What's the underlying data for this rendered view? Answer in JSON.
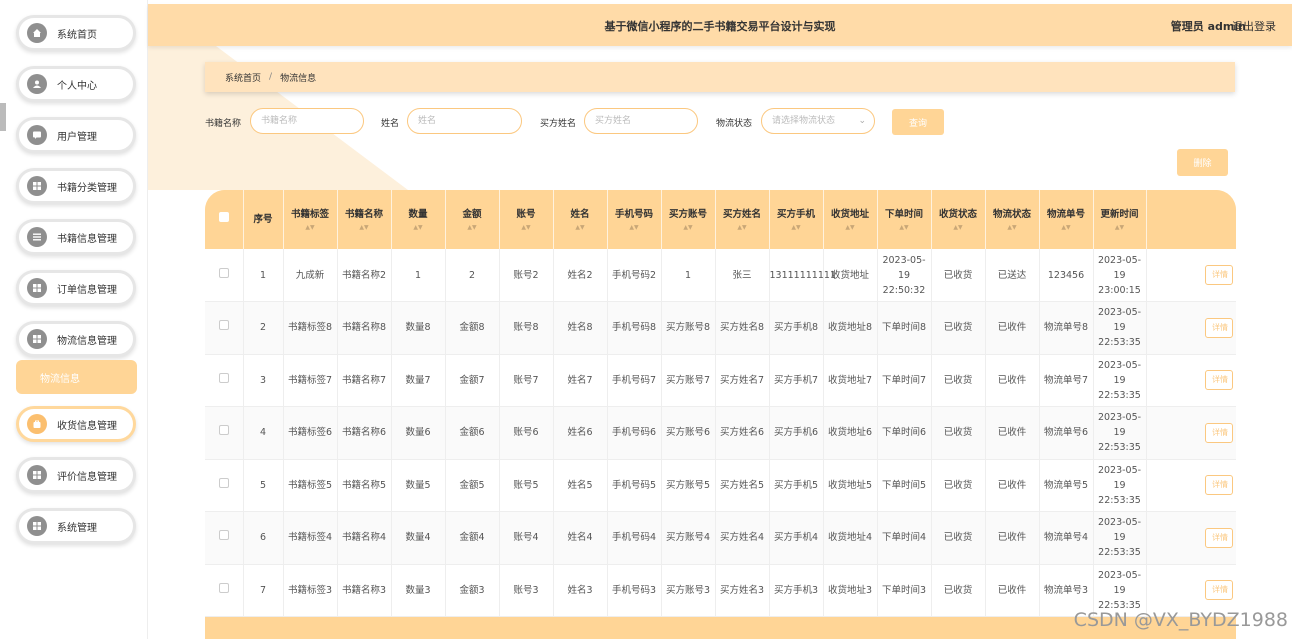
{
  "header": {
    "title": "基于微信小程序的二手书籍交易平台设计与实现",
    "user": "管理员 admin",
    "logout": "退出登录"
  },
  "sidebar": {
    "items": [
      {
        "label": "系统首页",
        "icon": "home-icon"
      },
      {
        "label": "个人中心",
        "icon": "user-icon"
      },
      {
        "label": "用户管理",
        "icon": "chat-icon"
      },
      {
        "label": "书籍分类管理",
        "icon": "grid-icon"
      },
      {
        "label": "书籍信息管理",
        "icon": "list-icon"
      },
      {
        "label": "订单信息管理",
        "icon": "grid-icon"
      },
      {
        "label": "物流信息管理",
        "icon": "grid-icon"
      },
      {
        "label": "物流信息",
        "icon": ""
      },
      {
        "label": "收货信息管理",
        "icon": "bag-icon"
      },
      {
        "label": "评价信息管理",
        "icon": "grid-icon"
      },
      {
        "label": "系统管理",
        "icon": "grid-icon"
      }
    ]
  },
  "breadcrumb": {
    "home": "系统首页",
    "sep": "/",
    "current": "物流信息"
  },
  "search": {
    "book_name_label": "书籍名称",
    "book_name_placeholder": "书籍名称",
    "name_label": "姓名",
    "name_placeholder": "姓名",
    "buyer_label": "买方姓名",
    "buyer_placeholder": "买方姓名",
    "status_label": "物流状态",
    "status_placeholder": "请选择物流状态",
    "query_button": "查询"
  },
  "delete_button": "删除",
  "table": {
    "columns": [
      "序号",
      "书籍标签",
      "书籍名称",
      "数量",
      "金额",
      "账号",
      "姓名",
      "手机号码",
      "买方账号",
      "买方姓名",
      "买方手机",
      "收货地址",
      "下单时间",
      "收货状态",
      "物流状态",
      "物流单号",
      "更新时间"
    ],
    "action_label": "详情",
    "rows": [
      [
        "1",
        "九成新",
        "书籍名称2",
        "1",
        "2",
        "账号2",
        "姓名2",
        "手机号码2",
        "1",
        "张三",
        "13111111111",
        "收货地址",
        "2023-05-19 22:50:32",
        "已收货",
        "已送达",
        "123456",
        "2023-05-19 23:00:15"
      ],
      [
        "2",
        "书籍标签8",
        "书籍名称8",
        "数量8",
        "金额8",
        "账号8",
        "姓名8",
        "手机号码8",
        "买方账号8",
        "买方姓名8",
        "买方手机8",
        "收货地址8",
        "下单时间8",
        "已收货",
        "已收件",
        "物流单号8",
        "2023-05-19 22:53:35"
      ],
      [
        "3",
        "书籍标签7",
        "书籍名称7",
        "数量7",
        "金额7",
        "账号7",
        "姓名7",
        "手机号码7",
        "买方账号7",
        "买方姓名7",
        "买方手机7",
        "收货地址7",
        "下单时间7",
        "已收货",
        "已收件",
        "物流单号7",
        "2023-05-19 22:53:35"
      ],
      [
        "4",
        "书籍标签6",
        "书籍名称6",
        "数量6",
        "金额6",
        "账号6",
        "姓名6",
        "手机号码6",
        "买方账号6",
        "买方姓名6",
        "买方手机6",
        "收货地址6",
        "下单时间6",
        "已收货",
        "已收件",
        "物流单号6",
        "2023-05-19 22:53:35"
      ],
      [
        "5",
        "书籍标签5",
        "书籍名称5",
        "数量5",
        "金额5",
        "账号5",
        "姓名5",
        "手机号码5",
        "买方账号5",
        "买方姓名5",
        "买方手机5",
        "收货地址5",
        "下单时间5",
        "已收货",
        "已收件",
        "物流单号5",
        "2023-05-19 22:53:35"
      ],
      [
        "6",
        "书籍标签4",
        "书籍名称4",
        "数量4",
        "金额4",
        "账号4",
        "姓名4",
        "手机号码4",
        "买方账号4",
        "买方姓名4",
        "买方手机4",
        "收货地址4",
        "下单时间4",
        "已收货",
        "已收件",
        "物流单号4",
        "2023-05-19 22:53:35"
      ],
      [
        "7",
        "书籍标签3",
        "书籍名称3",
        "数量3",
        "金额3",
        "账号3",
        "姓名3",
        "手机号码3",
        "买方账号3",
        "买方姓名3",
        "买方手机3",
        "收货地址3",
        "下单时间3",
        "已收货",
        "已收件",
        "物流单号3",
        "2023-05-19 22:53:35"
      ]
    ]
  },
  "watermark": "CSDN @VX_BYDZ1988",
  "colors": {
    "accent": "#ffd596",
    "header": "#ffdba8",
    "sidebar_border": "#e6e6e6"
  }
}
